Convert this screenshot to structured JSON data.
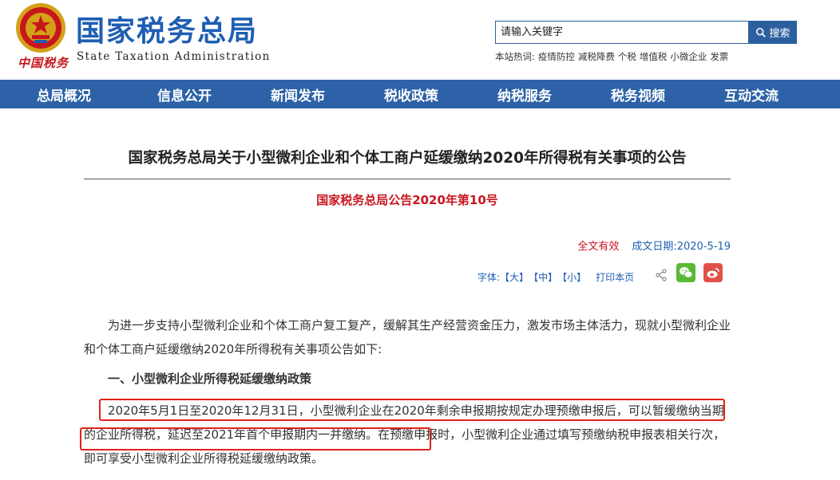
{
  "header": {
    "brand_cn": "国家税务总局",
    "brand_en": "State Taxation Administration",
    "brand_script": "中国税务",
    "search": {
      "placeholder": "请输入关键字",
      "button_label": "搜索"
    },
    "hot_label": "本站热词:",
    "hot_words": [
      "疫情防控",
      "减税降费",
      "个税",
      "增值税",
      "小微企业",
      "发票"
    ]
  },
  "nav": [
    "总局概况",
    "信息公开",
    "新闻发布",
    "税收政策",
    "纳税服务",
    "税务视频",
    "互动交流"
  ],
  "article": {
    "title": "国家税务总局关于小型微利企业和个体工商户延缓缴纳2020年所得税有关事项的公告",
    "subtitle": "国家税务总局公告2020年第10号",
    "validity": "全文有效",
    "date": "成文日期:2020-5-19",
    "tools": {
      "font_label": "字体:",
      "large": "【大】",
      "medium": "【中】",
      "small": "【小】",
      "print": "打印本页"
    },
    "paragraph1": "为进一步支持小型微利企业和个体工商户复工复产，缓解其生产经营资金压力，激发市场主体活力，现就小型微利企业和个体工商户延缓缴纳2020年所得税有关事项公告如下:",
    "heading1": "一、小型微利企业所得税延缓缴纳政策",
    "paragraph2": "2020年5月1日至2020年12月31日，小型微利企业在2020年剩余申报期按规定办理预缴申报后，可以暂缓缴纳当期的企业所得税，延迟至2021年首个申报期内一并缴纳。在预缴申报时，小型微利企业通过填写预缴纳税申报表相关行次，即可享受小型微利企业所得税延缓缴纳政策。"
  },
  "colors": {
    "nav_bg": "#2d62a8",
    "brand_blue": "#1e5fb3",
    "accent_red": "#c8161d",
    "highlight_red": "#e0221b"
  },
  "icons": [
    "national-emblem-icon",
    "search-icon",
    "share-icon",
    "wechat-icon",
    "weibo-icon"
  ]
}
